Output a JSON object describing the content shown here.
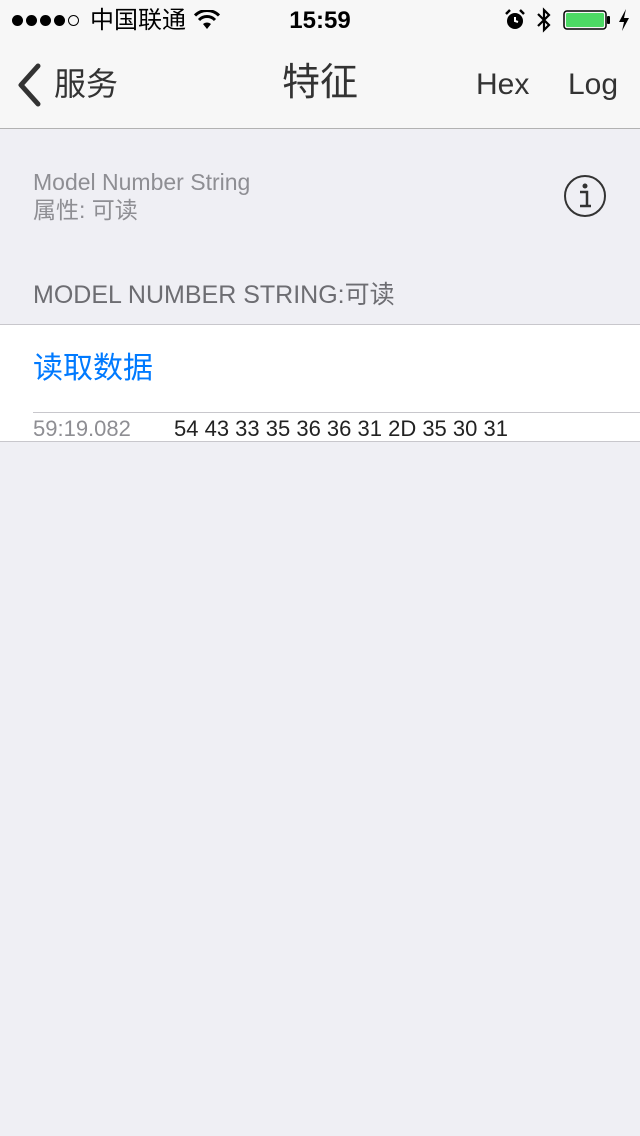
{
  "status_bar": {
    "carrier": "中国联通",
    "time": "15:59",
    "battery_color": "#4cd964"
  },
  "nav": {
    "back_label": "服务",
    "title": "特征",
    "hex_label": "Hex",
    "log_label": "Log"
  },
  "characteristic": {
    "name": "Model Number String",
    "properties": "属性: 可读"
  },
  "section": {
    "header": "MODEL NUMBER STRING:可读",
    "read_label": "读取数据",
    "entries": [
      {
        "timestamp": "59:19.082",
        "value": "54 43 33 35 36 36 31 2D 35 30 31"
      }
    ]
  },
  "colors": {
    "accent": "#007aff",
    "background": "#efeff4"
  }
}
